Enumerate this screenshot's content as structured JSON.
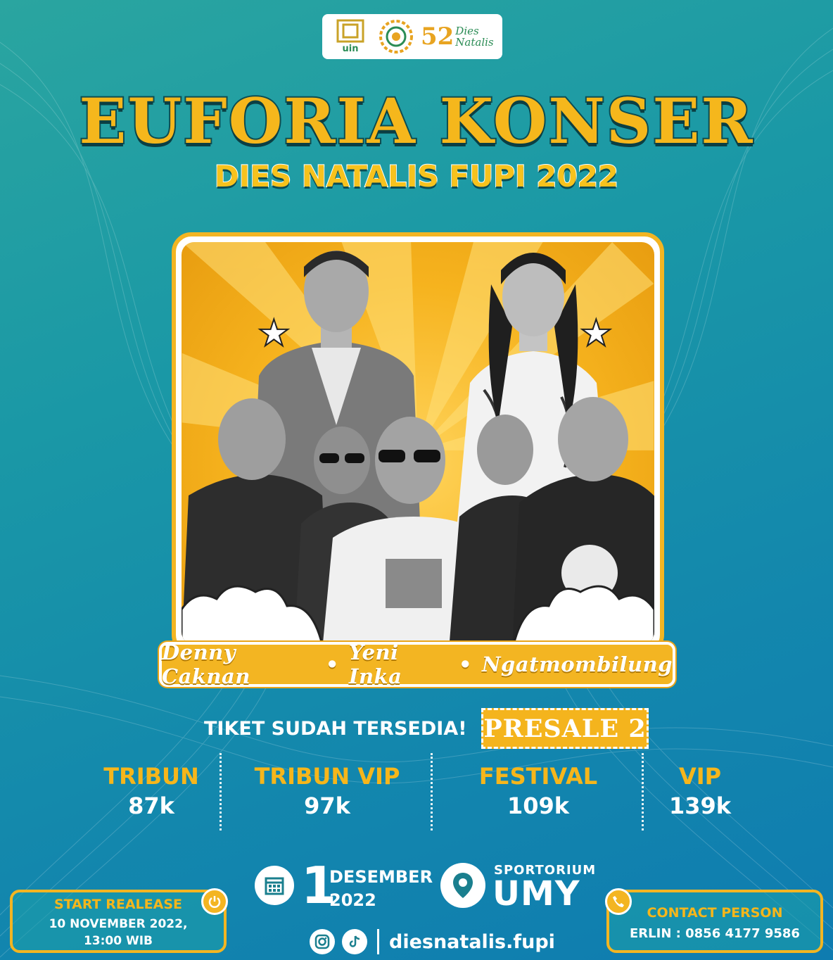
{
  "logos": {
    "uin_label": "uin",
    "dies_number": "52",
    "dies_text": "Dies Natalis"
  },
  "title": "EUFORIA KONSER",
  "subtitle": "DIES NATALIS FUPI 2022",
  "performers": [
    "Denny Caknan",
    "Yeni Inka",
    "Ngatmombilung"
  ],
  "performers_separator": "•",
  "tickets": {
    "header": "TIKET SUDAH TERSEDIA!",
    "presale": "PRESALE 2",
    "categories": [
      {
        "name": "TRIBUN",
        "price": "87k"
      },
      {
        "name": "TRIBUN VIP",
        "price": "97k"
      },
      {
        "name": "FESTIVAL",
        "price": "109k"
      },
      {
        "name": "VIP",
        "price": "139k"
      }
    ]
  },
  "event": {
    "day": "1",
    "month": "DESEMBER",
    "year": "2022",
    "venue_line1": "SPORTORIUM",
    "venue_line2": "UMY"
  },
  "social": {
    "handle": "diesnatalis.fupi",
    "icons": [
      "instagram-icon",
      "tiktok-icon"
    ]
  },
  "release": {
    "title": "START REALEASE",
    "line1": "10 NOVEMBER 2022,",
    "line2": "13:00 WIB"
  },
  "contact": {
    "title": "CONTACT PERSON",
    "line": "ERLIN : 0856 4177 9586"
  },
  "colors": {
    "accent_yellow": "#f3b522",
    "bg_teal": "#1a98a6",
    "bg_blue": "#0f7cb0"
  }
}
